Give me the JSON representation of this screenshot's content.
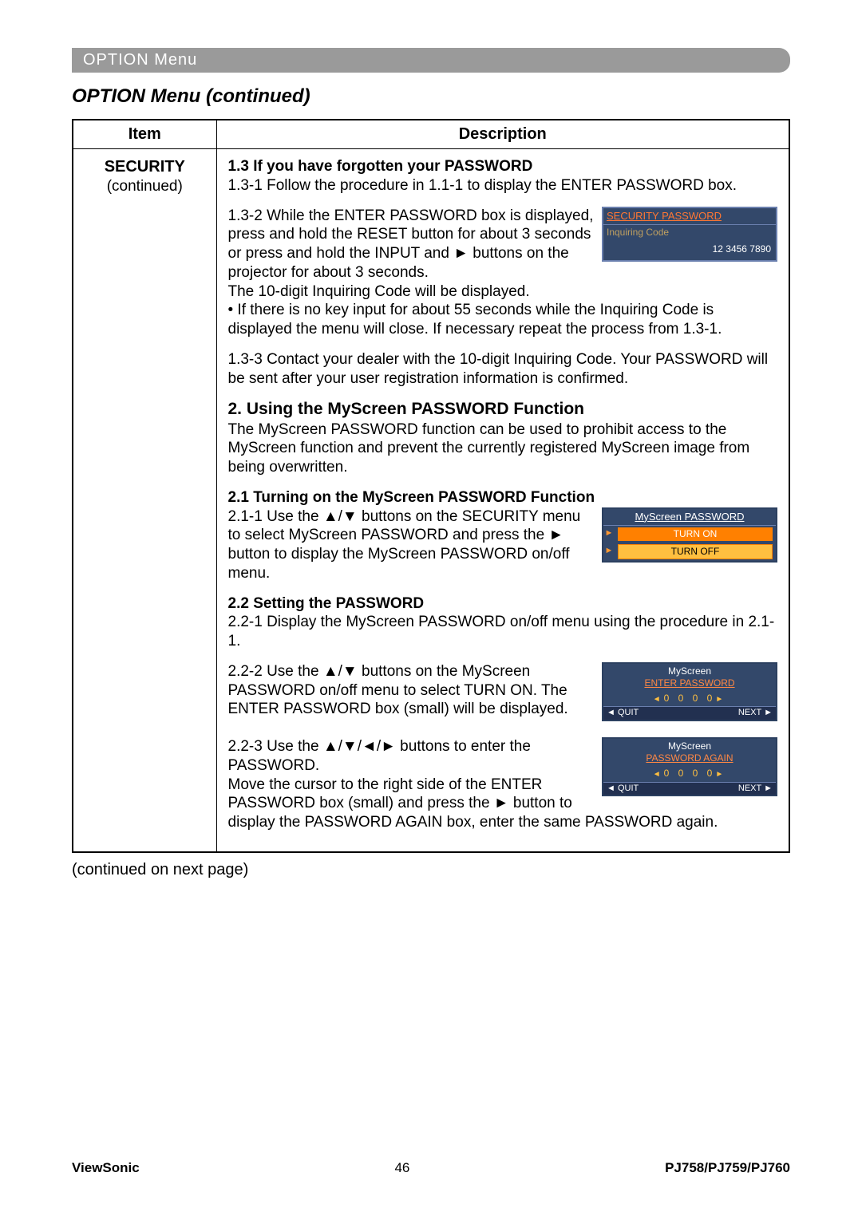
{
  "banner": "OPTION Menu",
  "heading": "OPTION Menu (continued)",
  "table": {
    "header_item": "Item",
    "header_desc": "Description",
    "item_label": "SECURITY",
    "item_sub": "(continued)"
  },
  "s13": {
    "title": "1.3 If you have forgotten your PASSWORD",
    "p131": "1.3-1 Follow the procedure in 1.1-1 to display the ENTER PASSWORD box.",
    "p132a": "1.3-2 While the ENTER PASSWORD box is displayed, press and hold the RESET button for about 3 seconds or press and hold the INPUT and ► buttons on the projector for about 3 seconds.",
    "p132b": "The 10-digit Inquiring Code will be displayed.",
    "p132c": "• If there is no key input for about 55 seconds while the Inquiring Code is displayed the menu will close. If necessary repeat the process from 1.3-1.",
    "p133": "1.3-3 Contact your dealer with the 10-digit Inquiring Code. Your PASSWORD will be sent after your user registration information is confirmed."
  },
  "osd1": {
    "title": "SECURITY PASSWORD",
    "sub": "Inquiring Code",
    "code": "12 3456 7890"
  },
  "s2": {
    "title": "2. Using the MyScreen PASSWORD Function",
    "intro": "The MyScreen PASSWORD function can be used to prohibit access to the MyScreen function and prevent the currently registered MyScreen image from being overwritten."
  },
  "s21": {
    "title": "2.1 Turning on the MyScreen PASSWORD Function",
    "p211": "2.1-1 Use the ▲/▼ buttons on the SECURITY menu to select MyScreen PASSWORD and press the ► button to display the MyScreen PASSWORD on/off menu."
  },
  "osd2": {
    "title": "MyScreen PASSWORD",
    "on": "TURN ON",
    "off": "TURN OFF"
  },
  "s22": {
    "title": "2.2 Setting the PASSWORD",
    "p221": "2.2-1 Display the MyScreen PASSWORD on/off menu using the procedure in 2.1-1.",
    "p222": "2.2-2 Use the ▲/▼ buttons on the MyScreen PASSWORD on/off menu to select TURN ON. The ENTER PASSWORD box (small) will be displayed.",
    "p223": "2.2-3 Use the ▲/▼/◄/► buttons to enter the PASSWORD.",
    "p223b": "Move the cursor to the right side of the ENTER PASSWORD box (small) and press the ► button to display the PASSWORD AGAIN box, enter the same PASSWORD again."
  },
  "osd3": {
    "t1": "MyScreen",
    "t2": "ENTER PASSWORD",
    "digits": "0 0 0 0",
    "quit": "◄ QUIT",
    "next": "NEXT ►"
  },
  "osd4": {
    "t1": "MyScreen",
    "t2": "PASSWORD AGAIN",
    "digits": "0 0 0 0",
    "quit": "◄ QUIT",
    "next": "NEXT ►"
  },
  "continued": "(continued on next page)",
  "footer": {
    "brand": "ViewSonic",
    "page": "46",
    "models": "PJ758/PJ759/PJ760"
  }
}
